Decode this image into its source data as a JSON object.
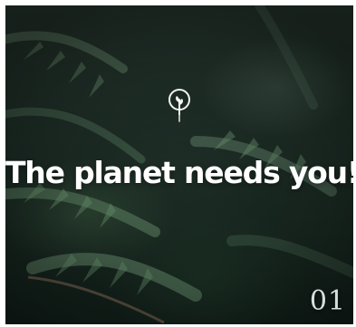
{
  "hero": {
    "headline": "The planet needs you!",
    "slide_number": "01"
  },
  "icons": {
    "logo": "sprout-in-circle-icon"
  },
  "colors": {
    "text": "#ffffff",
    "background_dark": "#1a2a23",
    "background_mid": "#27372f"
  }
}
